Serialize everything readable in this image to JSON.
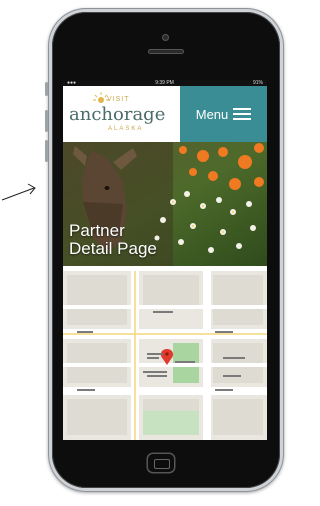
{
  "status_bar": {
    "time": "9:39 PM",
    "battery": "91%"
  },
  "logo": {
    "visit": "VISIT",
    "name": "anchorage",
    "region": "ALASKA"
  },
  "header": {
    "menu_label": "Menu"
  },
  "hero": {
    "title_line1": "Partner",
    "title_line2": "Detail Page"
  },
  "colors": {
    "header_teal": "#3b8d95",
    "logo_green": "#4a6d6a",
    "logo_gold": "#c9a94b"
  }
}
